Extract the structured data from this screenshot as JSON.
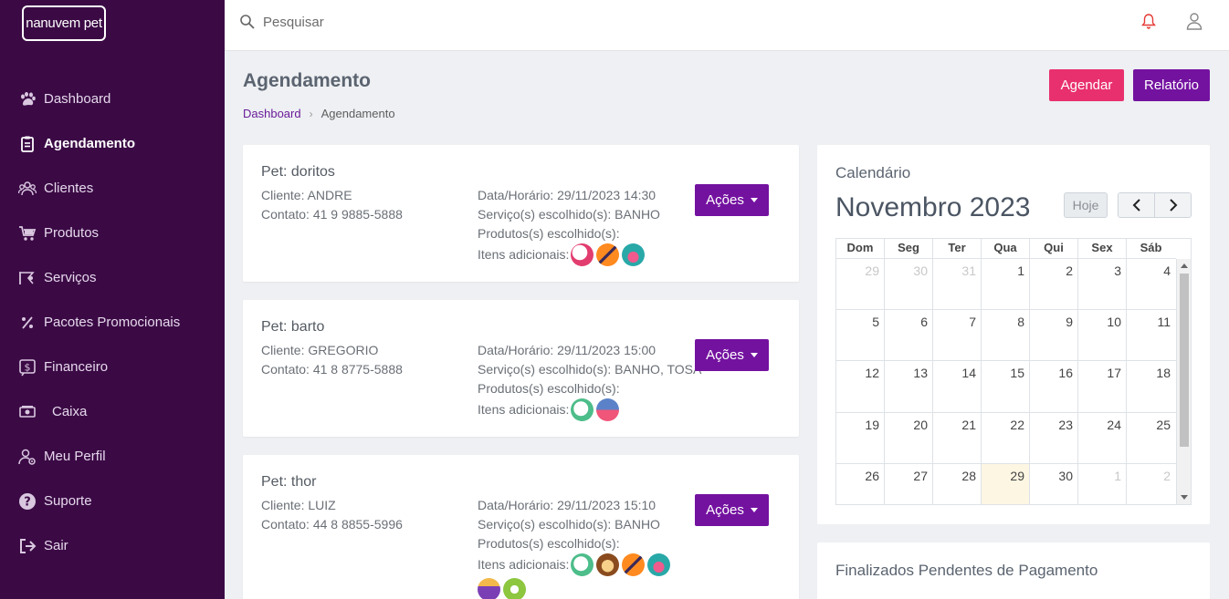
{
  "app": {
    "logo_text": "nanuvem pet"
  },
  "sidebar": {
    "items": [
      {
        "label": "Dashboard",
        "icon": "paw-icon",
        "active": false
      },
      {
        "label": "Agendamento",
        "icon": "clipboard-icon",
        "active": true
      },
      {
        "label": "Clientes",
        "icon": "users-icon",
        "active": false
      },
      {
        "label": "Produtos",
        "icon": "cart-icon",
        "active": false
      },
      {
        "label": "Serviços",
        "icon": "scissors-icon",
        "active": false
      },
      {
        "label": "Pacotes Promocionais",
        "icon": "percent-icon",
        "active": false
      },
      {
        "label": "Financeiro",
        "icon": "dollar-icon",
        "active": false
      },
      {
        "label": "Caixa",
        "icon": "cash-icon",
        "active": false
      },
      {
        "label": "Meu Perfil",
        "icon": "user-gear-icon",
        "active": false
      },
      {
        "label": "Suporte",
        "icon": "help-icon",
        "active": false
      },
      {
        "label": "Sair",
        "icon": "logout-icon",
        "active": false
      }
    ]
  },
  "topbar": {
    "search_placeholder": "Pesquisar"
  },
  "page": {
    "title": "Agendamento",
    "breadcrumb": {
      "home": "Dashboard",
      "current": "Agendamento"
    },
    "agendar_label": "Agendar",
    "relatorio_label": "Relatório"
  },
  "appointments": [
    {
      "pet": "Pet: doritos",
      "client": "Cliente: ANDRE",
      "contact": "Contato: 41 9 9885-5888",
      "datetime": "Data/Horário: 29/11/2023 14:30",
      "services": "Serviço(s) escolhido(s): BANHO",
      "products": "Produtos(s) escolhido(s):",
      "addons_label": "Itens adicionais:",
      "actions_label": "Ações"
    },
    {
      "pet": "Pet: barto",
      "client": "Cliente: GREGORIO",
      "contact": "Contato: 41 8 8775-5888",
      "datetime": "Data/Horário: 29/11/2023 15:00",
      "services": "Serviço(s) escolhido(s): BANHO, TOSA",
      "products": "Produtos(s) escolhido(s):",
      "addons_label": "Itens adicionais:",
      "actions_label": "Ações"
    },
    {
      "pet": "Pet: thor",
      "client": "Cliente: LUIZ",
      "contact": "Contato: 44 8 8855-5996",
      "datetime": "Data/Horário: 29/11/2023 15:10",
      "services": "Serviço(s) escolhido(s): BANHO",
      "products": "Produtos(s) escolhido(s):",
      "addons_label": "Itens adicionais:",
      "actions_label": "Ações"
    }
  ],
  "calendar": {
    "title": "Calendário",
    "month": "Novembro 2023",
    "today_label": "Hoje",
    "weekdays": [
      "Dom",
      "Seg",
      "Ter",
      "Qua",
      "Qui",
      "Sex",
      "Sáb"
    ],
    "weeks": [
      [
        "29",
        "30",
        "31",
        "1",
        "2",
        "3",
        "4"
      ],
      [
        "5",
        "6",
        "7",
        "8",
        "9",
        "10",
        "11"
      ],
      [
        "12",
        "13",
        "14",
        "15",
        "16",
        "17",
        "18"
      ],
      [
        "19",
        "20",
        "21",
        "22",
        "23",
        "24",
        "25"
      ],
      [
        "26",
        "27",
        "28",
        "29",
        "30",
        "1",
        "2"
      ]
    ]
  },
  "pending": {
    "title": "Finalizados Pendentes de Pagamento"
  },
  "colors": {
    "sidebar": "#3b0a45",
    "primary": "#7412a0",
    "accent": "#e9306e",
    "today": "#fdf6e3"
  }
}
